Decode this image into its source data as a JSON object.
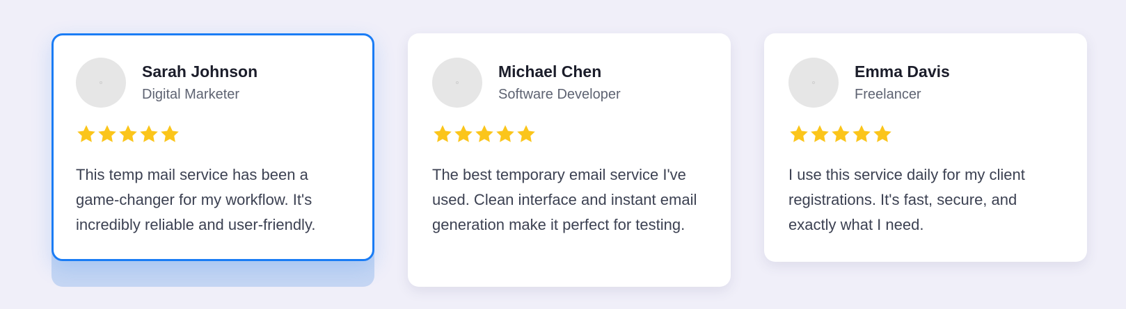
{
  "colors": {
    "page_bg": "#f0eff9",
    "card_bg": "#ffffff",
    "active_border": "#1a7cf5",
    "star": "#fbc51b",
    "avatar_bg": "#e6e6e6"
  },
  "testimonials": [
    {
      "name": "Sarah Johnson",
      "role": "Digital Marketer",
      "rating": 5,
      "text": "This temp mail service has been a game-changer for my workflow. It's incredibly reliable and user-friendly.",
      "active": true
    },
    {
      "name": "Michael Chen",
      "role": "Software Developer",
      "rating": 5,
      "text": "The best temporary email service I've used. Clean interface and instant email generation make it perfect for testing.",
      "active": false
    },
    {
      "name": "Emma Davis",
      "role": "Freelancer",
      "rating": 5,
      "text": "I use this service daily for my client registrations. It's fast, secure, and exactly what I need.",
      "active": false
    }
  ]
}
